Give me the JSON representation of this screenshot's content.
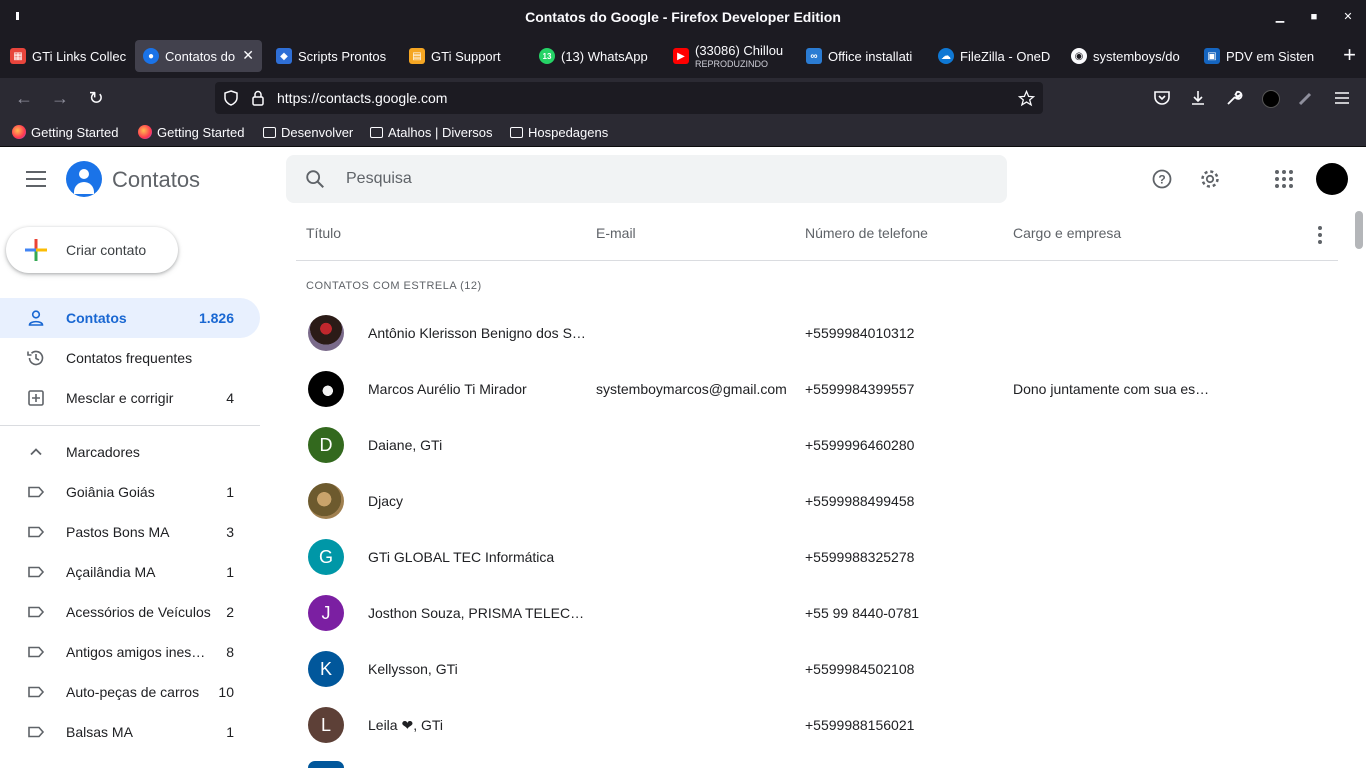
{
  "window": {
    "title": "Contatos do Google - Firefox Developer Edition"
  },
  "tabs": [
    {
      "label": "GTi Links Collec",
      "icon": "gti-links-favicon",
      "color": "#e8453c"
    },
    {
      "label": "Contatos do",
      "icon": "contacts-favicon",
      "color": "#1a73e8",
      "active": true
    },
    {
      "label": "Scripts Prontos",
      "icon": "scripts-favicon",
      "color": "#2f6fd6"
    },
    {
      "label": "GTi Support",
      "icon": "gti-support-favicon",
      "color": "#f5a623"
    },
    {
      "label": "(13) WhatsApp",
      "icon": "whatsapp-favicon",
      "color": "#25d366",
      "badge": "13"
    },
    {
      "label": "(33086) Chillou",
      "sub": "REPRODUZINDO",
      "icon": "youtube-favicon",
      "color": "#ff0000"
    },
    {
      "label": "Office installati",
      "icon": "office-favicon",
      "color": "#2b7cd3"
    },
    {
      "label": "FileZilla - OneD",
      "icon": "onedrive-favicon",
      "color": "#0f78d4"
    },
    {
      "label": "systemboys/do",
      "icon": "github-favicon",
      "color": "#fbfbfe"
    },
    {
      "label": "PDV em Sisten",
      "icon": "pdv-favicon",
      "color": "#1565c0"
    }
  ],
  "nav": {
    "url": "https://contacts.google.com"
  },
  "bookmarks": [
    {
      "label": "Getting Started",
      "type": "firefox"
    },
    {
      "label": "Getting Started",
      "type": "firefox"
    },
    {
      "label": "Desenvolver",
      "type": "folder"
    },
    {
      "label": "Atalhos | Diversos",
      "type": "folder"
    },
    {
      "label": "Hospedagens",
      "type": "folder"
    }
  ],
  "app": {
    "title": "Contatos",
    "search_placeholder": "Pesquisa",
    "create_label": "Criar contato"
  },
  "sidebar": {
    "contacts": {
      "label": "Contatos",
      "count": "1.826"
    },
    "frequent": {
      "label": "Contatos frequentes"
    },
    "merge": {
      "label": "Mesclar e corrigir",
      "count": "4"
    },
    "labels_header": "Marcadores",
    "labels": [
      {
        "label": "Goiânia Goiás",
        "count": "1"
      },
      {
        "label": "Pastos Bons MA",
        "count": "3"
      },
      {
        "label": "Açailândia MA",
        "count": "1"
      },
      {
        "label": "Acessórios de Veículos",
        "count": "2"
      },
      {
        "label": "Antigos amigos inesquecíveis",
        "count": "8"
      },
      {
        "label": "Auto-peças de carros",
        "count": "10"
      },
      {
        "label": "Balsas MA",
        "count": "1"
      }
    ]
  },
  "table": {
    "headers": {
      "title": "Título",
      "email": "E-mail",
      "phone": "Número de telefone",
      "job": "Cargo e empresa"
    },
    "section": "CONTATOS COM ESTRELA (12)",
    "rows": [
      {
        "name": "Antônio Klerisson Benigno dos Santos",
        "email": "",
        "phone": "+5599984010312",
        "job": "",
        "avatar": "photo",
        "color": "#6b3a2a"
      },
      {
        "name": "Marcos Aurélio Ti Mirador",
        "email": "systemboymarcos@gmail.com",
        "phone": "+5599984399557",
        "job": "Dono juntamente com sua esposa",
        "avatar": "photo",
        "color": "#000000"
      },
      {
        "name": "Daiane, GTi",
        "email": "",
        "phone": "+5599996460280",
        "job": "",
        "avatar": "D",
        "color": "#33691e"
      },
      {
        "name": "Djacy",
        "email": "",
        "phone": "+5599988499458",
        "job": "",
        "avatar": "photo",
        "color": "#8d6e3f"
      },
      {
        "name": "GTi GLOBAL TEC Informática",
        "email": "",
        "phone": "+5599988325278",
        "job": "",
        "avatar": "G",
        "color": "#0097a7"
      },
      {
        "name": "Josthon Souza, PRISMA TELECOM",
        "email": "",
        "phone": "+55 99 8440-0781",
        "job": "",
        "avatar": "J",
        "color": "#7b1fa2"
      },
      {
        "name": "Kellysson, GTi",
        "email": "",
        "phone": "+5599984502108",
        "job": "",
        "avatar": "K",
        "color": "#01579b"
      },
      {
        "name": "Leila ❤, GTi",
        "email": "",
        "phone": "+5599988156021",
        "job": "",
        "avatar": "L",
        "color": "#5d4037"
      }
    ]
  }
}
